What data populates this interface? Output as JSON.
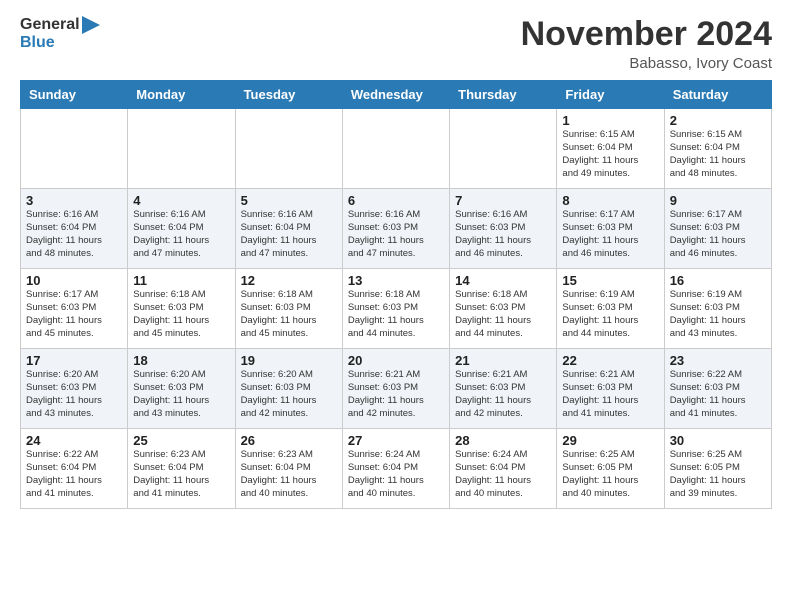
{
  "header": {
    "logo_general": "General",
    "logo_blue": "Blue",
    "title": "November 2024",
    "location": "Babasso, Ivory Coast"
  },
  "weekdays": [
    "Sunday",
    "Monday",
    "Tuesday",
    "Wednesday",
    "Thursday",
    "Friday",
    "Saturday"
  ],
  "weeks": [
    [
      {
        "day": "",
        "info": ""
      },
      {
        "day": "",
        "info": ""
      },
      {
        "day": "",
        "info": ""
      },
      {
        "day": "",
        "info": ""
      },
      {
        "day": "",
        "info": ""
      },
      {
        "day": "1",
        "info": "Sunrise: 6:15 AM\nSunset: 6:04 PM\nDaylight: 11 hours\nand 49 minutes."
      },
      {
        "day": "2",
        "info": "Sunrise: 6:15 AM\nSunset: 6:04 PM\nDaylight: 11 hours\nand 48 minutes."
      }
    ],
    [
      {
        "day": "3",
        "info": "Sunrise: 6:16 AM\nSunset: 6:04 PM\nDaylight: 11 hours\nand 48 minutes."
      },
      {
        "day": "4",
        "info": "Sunrise: 6:16 AM\nSunset: 6:04 PM\nDaylight: 11 hours\nand 47 minutes."
      },
      {
        "day": "5",
        "info": "Sunrise: 6:16 AM\nSunset: 6:04 PM\nDaylight: 11 hours\nand 47 minutes."
      },
      {
        "day": "6",
        "info": "Sunrise: 6:16 AM\nSunset: 6:03 PM\nDaylight: 11 hours\nand 47 minutes."
      },
      {
        "day": "7",
        "info": "Sunrise: 6:16 AM\nSunset: 6:03 PM\nDaylight: 11 hours\nand 46 minutes."
      },
      {
        "day": "8",
        "info": "Sunrise: 6:17 AM\nSunset: 6:03 PM\nDaylight: 11 hours\nand 46 minutes."
      },
      {
        "day": "9",
        "info": "Sunrise: 6:17 AM\nSunset: 6:03 PM\nDaylight: 11 hours\nand 46 minutes."
      }
    ],
    [
      {
        "day": "10",
        "info": "Sunrise: 6:17 AM\nSunset: 6:03 PM\nDaylight: 11 hours\nand 45 minutes."
      },
      {
        "day": "11",
        "info": "Sunrise: 6:18 AM\nSunset: 6:03 PM\nDaylight: 11 hours\nand 45 minutes."
      },
      {
        "day": "12",
        "info": "Sunrise: 6:18 AM\nSunset: 6:03 PM\nDaylight: 11 hours\nand 45 minutes."
      },
      {
        "day": "13",
        "info": "Sunrise: 6:18 AM\nSunset: 6:03 PM\nDaylight: 11 hours\nand 44 minutes."
      },
      {
        "day": "14",
        "info": "Sunrise: 6:18 AM\nSunset: 6:03 PM\nDaylight: 11 hours\nand 44 minutes."
      },
      {
        "day": "15",
        "info": "Sunrise: 6:19 AM\nSunset: 6:03 PM\nDaylight: 11 hours\nand 44 minutes."
      },
      {
        "day": "16",
        "info": "Sunrise: 6:19 AM\nSunset: 6:03 PM\nDaylight: 11 hours\nand 43 minutes."
      }
    ],
    [
      {
        "day": "17",
        "info": "Sunrise: 6:20 AM\nSunset: 6:03 PM\nDaylight: 11 hours\nand 43 minutes."
      },
      {
        "day": "18",
        "info": "Sunrise: 6:20 AM\nSunset: 6:03 PM\nDaylight: 11 hours\nand 43 minutes."
      },
      {
        "day": "19",
        "info": "Sunrise: 6:20 AM\nSunset: 6:03 PM\nDaylight: 11 hours\nand 42 minutes."
      },
      {
        "day": "20",
        "info": "Sunrise: 6:21 AM\nSunset: 6:03 PM\nDaylight: 11 hours\nand 42 minutes."
      },
      {
        "day": "21",
        "info": "Sunrise: 6:21 AM\nSunset: 6:03 PM\nDaylight: 11 hours\nand 42 minutes."
      },
      {
        "day": "22",
        "info": "Sunrise: 6:21 AM\nSunset: 6:03 PM\nDaylight: 11 hours\nand 41 minutes."
      },
      {
        "day": "23",
        "info": "Sunrise: 6:22 AM\nSunset: 6:03 PM\nDaylight: 11 hours\nand 41 minutes."
      }
    ],
    [
      {
        "day": "24",
        "info": "Sunrise: 6:22 AM\nSunset: 6:04 PM\nDaylight: 11 hours\nand 41 minutes."
      },
      {
        "day": "25",
        "info": "Sunrise: 6:23 AM\nSunset: 6:04 PM\nDaylight: 11 hours\nand 41 minutes."
      },
      {
        "day": "26",
        "info": "Sunrise: 6:23 AM\nSunset: 6:04 PM\nDaylight: 11 hours\nand 40 minutes."
      },
      {
        "day": "27",
        "info": "Sunrise: 6:24 AM\nSunset: 6:04 PM\nDaylight: 11 hours\nand 40 minutes."
      },
      {
        "day": "28",
        "info": "Sunrise: 6:24 AM\nSunset: 6:04 PM\nDaylight: 11 hours\nand 40 minutes."
      },
      {
        "day": "29",
        "info": "Sunrise: 6:25 AM\nSunset: 6:05 PM\nDaylight: 11 hours\nand 40 minutes."
      },
      {
        "day": "30",
        "info": "Sunrise: 6:25 AM\nSunset: 6:05 PM\nDaylight: 11 hours\nand 39 minutes."
      }
    ]
  ]
}
